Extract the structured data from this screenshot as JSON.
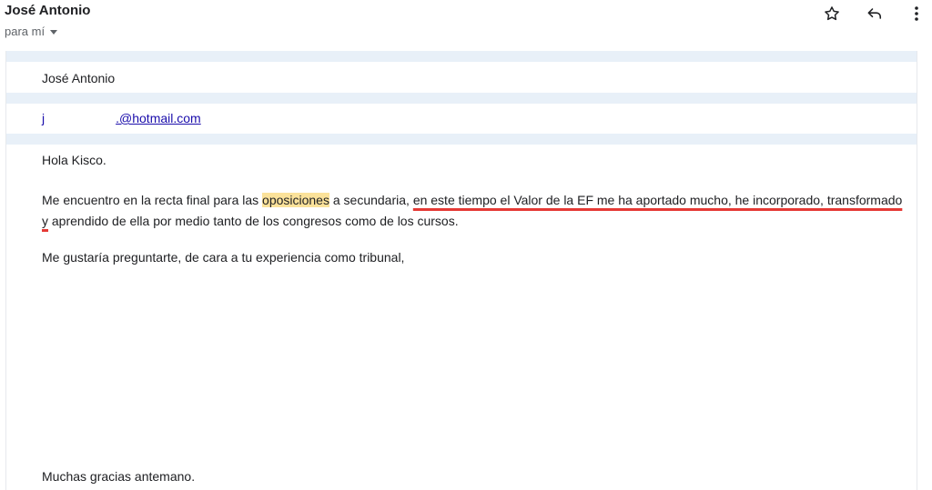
{
  "header": {
    "sender_name": "José Antonio",
    "recipient_label": "para mí",
    "icons": [
      "star-icon",
      "reply-icon",
      "more-vert-icon"
    ]
  },
  "email": {
    "from_name": "José Antonio",
    "email_prefix": "j",
    "email_suffix": ".@hotmail.com",
    "greeting": "Hola Kisco.",
    "para1_start": "Me encuentro en la recta final para las ",
    "para1_highlight": "oposiciones",
    "para1_mid": " a secundaria, ",
    "para1_underlined": "en este tiempo el Valor de la EF me ha aportado mucho, he incorporado, transformado y",
    "para1_end": " aprendido de ella por medio tanto de los congresos como de los cursos.",
    "para2": "Me gustaría preguntarte, de cara a tu experiencia como tribunal,",
    "closing": "Muchas gracias antemano."
  },
  "colors": {
    "highlight": "#fbe29a",
    "underline": "#e53935",
    "link": "#1a0dab",
    "separator": "#e8f0f8"
  }
}
